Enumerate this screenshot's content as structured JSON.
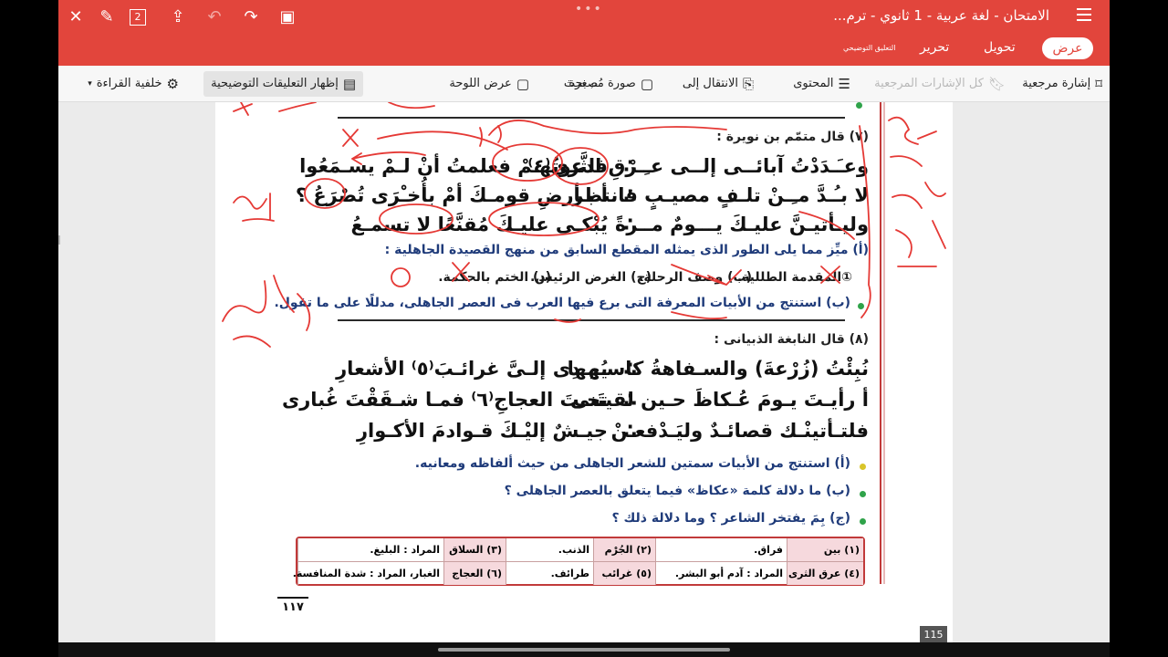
{
  "window": {
    "doc_title": "الامتحان - لغة عربية - 1 ثانوي - ترم...",
    "dots": "•••",
    "page_badge": "2"
  },
  "mode_tabs": {
    "view": "عرض",
    "convert": "تحويل",
    "edit": "تحرير",
    "annotate": "التعليق التوضيحي"
  },
  "toolbar": {
    "bookmark": "إشارة مرجعية",
    "all_bookmarks": "كل الإشارات المرجعية",
    "contents": "المحتوى",
    "goto": "الانتقال إلى",
    "thumbnail": "صورة مُصغرة",
    "search": "بحث",
    "board_view": "عرض اللوحة",
    "show_annotations": "إظهار التعليقات التوضيحية",
    "reading_bg": "خلفية القراءة"
  },
  "page": {
    "header7": "(٧) قال متمّم بن نويرة :",
    "poem7": [
      {
        "r": "وعـَـدَدْتُ آبائــى إلــى عـِـرْقِ الثَّرى⁽٤⁾",
        "l": "فدعوتُهـمْ فعلمتُ أنْ لـمْ يسـمَعُوا"
      },
      {
        "r": "لا بـُـدَّ مـِـنْ تلـفٍ مصيـبٍ فانتظر",
        "l": "أ بـأرضِ قومـكَ أمْ بأُخـْرَى تُصْرَعُ ؟"
      },
      {
        "r": "وليـأتيـنَّ عليـكَ يـــومٌ مــرةً",
        "l": "يُبْكـى عليـكَ مُقنَّعًا لا تسمـعُ"
      }
    ],
    "q7a": "(أ) ميِّز مما يلى الطور الذى يمثله المقطع السابق من منهج القصيدة الجاهلية :",
    "q7a_options": [
      "①المقدمة الطللية.",
      "(ب) وصف الرحلة.",
      "(ج) الغرض الرئيس.",
      "(د) الختم بالحكمة."
    ],
    "q7b": "(ب) استنتج من الأبيات المعرفة التى برع فيها العرب فى العصر الجاهلى، مدللًا على ما تقول.",
    "header8": "(٨) قال النابغة الذبيانى :",
    "poem8": [
      {
        "r": "نُبِئْتُ (زُرْعةَ) والسـفاهةُ كاسـمِها",
        "l": "يُهـدِى إلـىَّ غرائـبَ⁽٥⁾ الأشعارِ"
      },
      {
        "r": "أ رأيـتَ يـومَ عُـكاظَ حـين لقيتَنى",
        "l": "تحـتَ العجاجِ⁽٦⁾ فمـا شـقَقْتَ غُبارى"
      },
      {
        "r": "فلتـأتينْـك قصائـدٌ وليَـدْفعـنْ",
        "l": "جيـشٌ إليْـكَ قـوادمَ الأكـوارِ"
      }
    ],
    "q8a": "(أ) استنتج من الأبيات سمتين للشعر الجاهلى من حيث ألفاظه ومعانيه.",
    "q8b": "(ب) ما دلالة كلمة «عكاظ» فيما يتعلق بالعصر الجاهلى ؟",
    "q8c": "(ج) بِمَ يفتخر الشاعر ؟ وما دلالة ذلك ؟",
    "glossary": [
      [
        {
          "k": "(١) بين",
          "v": "فراق."
        },
        {
          "k": "(٢) الجُرْم",
          "v": "الذنب."
        },
        {
          "k": "(٣) السلاق",
          "v": "المراد : البليغ."
        }
      ],
      [
        {
          "k": "(٤) عرق الثرى",
          "v": "المراد : آدم أبو البشر."
        },
        {
          "k": "(٥) غرائب",
          "v": "طرائف."
        },
        {
          "k": "(٦) العجاج",
          "v": "الغبار، المراد : شدة المنافسة."
        }
      ]
    ],
    "folio": "١١٧",
    "handwriting": {
      "left1": "الموت",
      "left2": "الفراسة",
      "right1": "غزل",
      "right2": "وصف",
      "right3": "غرض",
      "right4": "الحكمة"
    }
  },
  "status": {
    "page_number": "115"
  },
  "colors": {
    "brand": "#e2453c",
    "ink_red": "#e53935",
    "accent_green": "#2fa34a"
  }
}
